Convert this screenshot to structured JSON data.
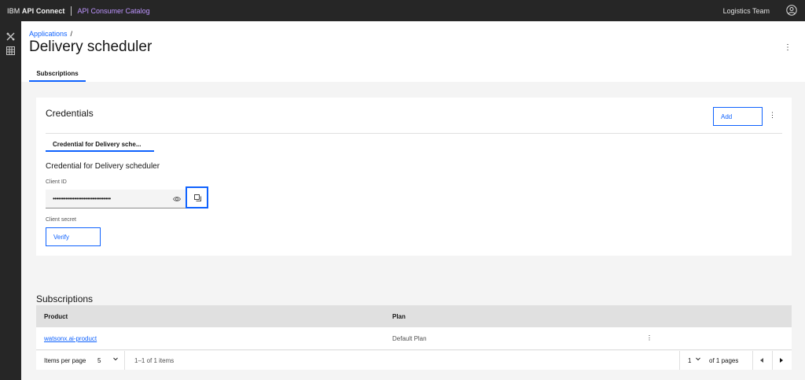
{
  "topbar": {
    "brand_prefix": "IBM",
    "brand_name": "API Connect",
    "catalog_label": "API Consumer Catalog",
    "team_name": "Logistics Team",
    "user_icon": "user-avatar-icon"
  },
  "sidebar": {
    "icons": [
      "tools-icon",
      "grid-icon"
    ]
  },
  "header": {
    "breadcrumb": {
      "link": "Applications",
      "separator": "/"
    },
    "title": "Delivery scheduler",
    "overflow": "⋮",
    "tabs": [
      {
        "label": "Subscriptions",
        "active": true
      }
    ]
  },
  "credentials": {
    "title": "Credentials",
    "add_label": "Add",
    "overflow": "⋮",
    "tab_label": "Credential for Delivery sche...",
    "name": "Credential for Delivery scheduler",
    "client_id_label": "Client ID",
    "client_id_value": "••••••••••••••••••••••••••••••••",
    "client_secret_label": "Client secret",
    "verify_label": "Verify"
  },
  "subscriptions": {
    "title": "Subscriptions",
    "columns": [
      "Product",
      "Plan"
    ],
    "rows": [
      {
        "product": "watsonx.ai-product",
        "plan": "Default Plan",
        "overflow": "⋮"
      }
    ],
    "pagination": {
      "items_per_page_label": "Items per page",
      "items_per_page": "5",
      "range": "1–1 of 1 items",
      "page": "1",
      "page_of": "of 1 pages"
    }
  },
  "colors": {
    "accent": "#0f62fe",
    "topbar_bg": "#262626",
    "page_bg": "#f4f4f4"
  }
}
